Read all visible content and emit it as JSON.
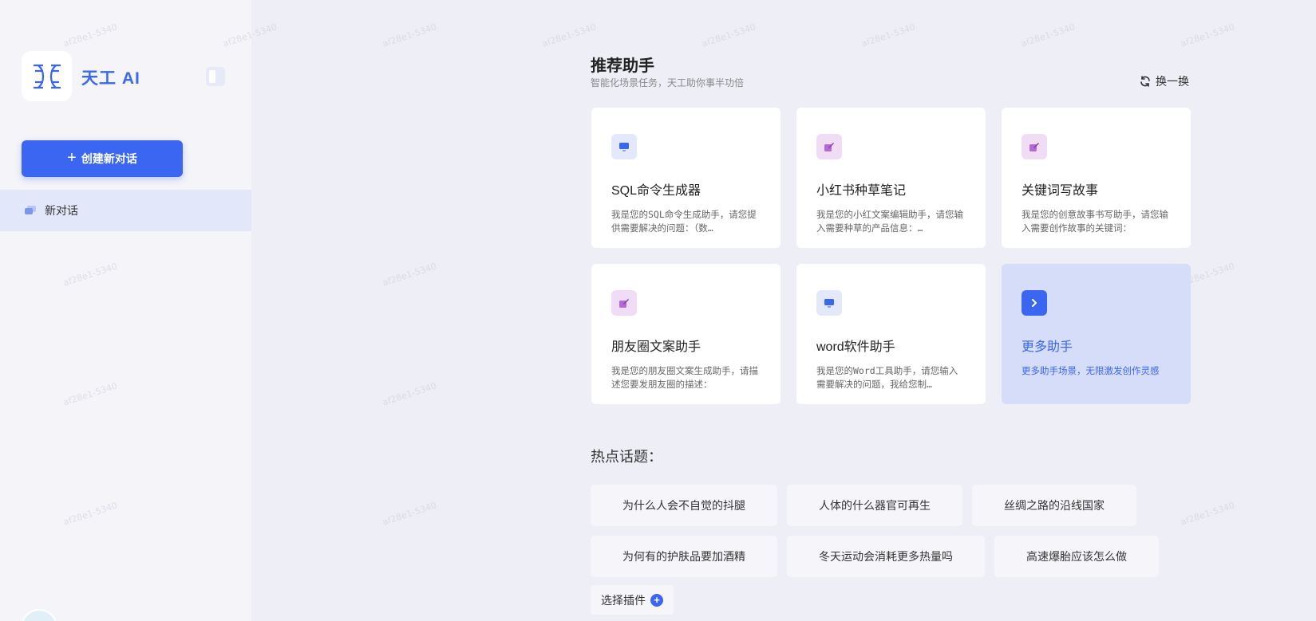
{
  "sidebar": {
    "app_name": "天工 AI",
    "new_chat_label": "创建新对话",
    "conversations": [
      {
        "label": "新对话"
      }
    ]
  },
  "assistants": {
    "title": "推荐助手",
    "subtitle": "智能化场景任务，天工助你事半功倍",
    "refresh_label": "换一换",
    "cards": [
      {
        "title": "SQL命令生成器",
        "desc": "我是您的SQL命令生成助手，请您提供需要解决的问题：（数…",
        "icon": "monitor-icon"
      },
      {
        "title": "小红书种草笔记",
        "desc": "我是您的小红文案编辑助手，请您输入需要种草的产品信息：…",
        "icon": "pen-icon"
      },
      {
        "title": "关键词写故事",
        "desc": "我是您的创意故事书写助手，请您输入需要创作故事的关键词：",
        "icon": "pen-icon"
      },
      {
        "title": "朋友圈文案助手",
        "desc": "我是您的朋友圈文案生成助手，请描述您要发朋友圈的描述：",
        "icon": "pen-icon"
      },
      {
        "title": "word软件助手",
        "desc": "我是您的Word工具助手，请您输入需要解决的问题，我给您制…",
        "icon": "monitor-icon"
      },
      {
        "title": "更多助手",
        "desc": "更多助手场景，无限激发创作灵感",
        "icon": "chevron-right-icon"
      }
    ]
  },
  "hot_topics": {
    "title": "热点话题：",
    "items": [
      "为什么人会不自觉的抖腿",
      "人体的什么器官可再生",
      "丝绸之路的沿线国家",
      "为何有的护肤品要加酒精",
      "冬天运动会消耗更多热量吗",
      "高速爆胎应该怎么做"
    ]
  },
  "plugin": {
    "label": "选择插件"
  },
  "watermark": "af28e1-5340",
  "colors": {
    "accent": "#3a66f2",
    "sidebar_bg": "#f4f4f9",
    "main_bg": "#eeeff6",
    "selected_bg": "#e3e7fa"
  }
}
